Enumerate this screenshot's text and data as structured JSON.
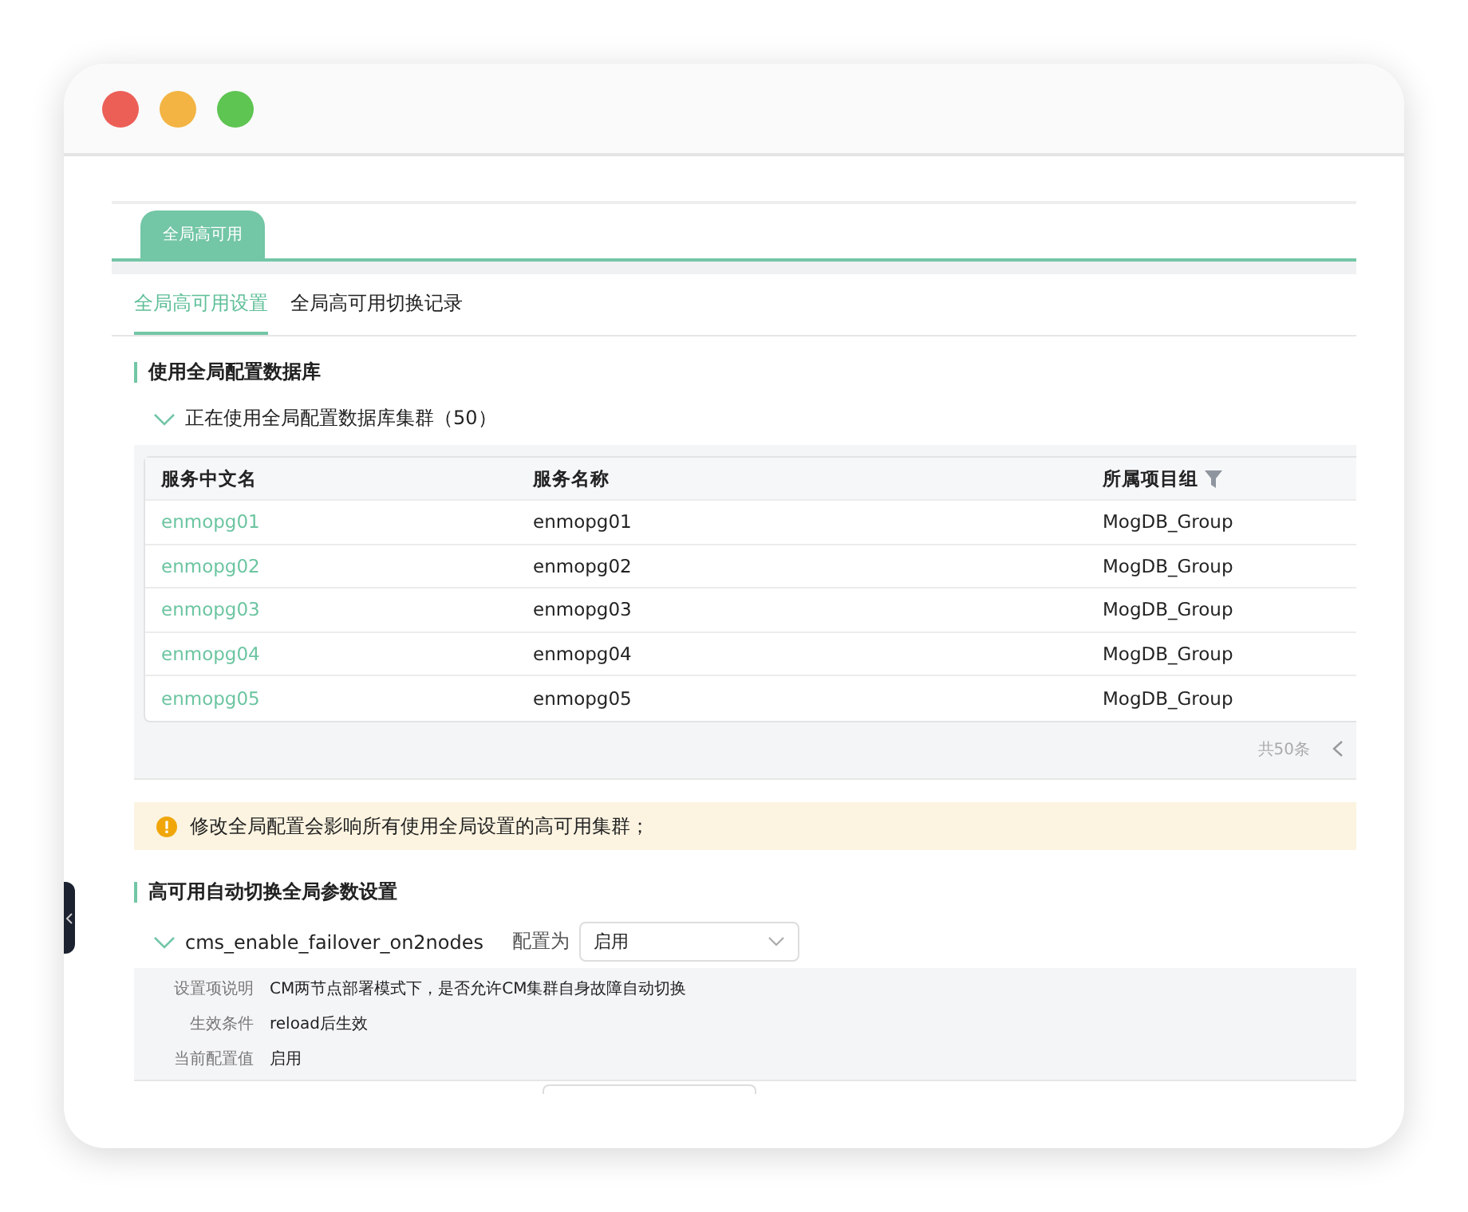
{
  "top_tabs": [
    {
      "label": "全局高可用",
      "selected": true
    }
  ],
  "sub_tabs": [
    {
      "label": "全局高可用设置",
      "selected": true
    },
    {
      "label": "全局高可用切换记录",
      "selected": false
    }
  ],
  "section1": {
    "title": "使用全局配置数据库",
    "group": {
      "label": "正在使用全局配置数据库集群（50）",
      "expanded": true
    }
  },
  "table": {
    "columns": [
      {
        "label": "服务中文名",
        "kind": "plain"
      },
      {
        "label": "服务名称",
        "kind": "plain"
      },
      {
        "label": "所属项目组",
        "kind": "filterable"
      }
    ],
    "rows": [
      [
        "enmopg01",
        "enmopg01",
        "MogDB_Group"
      ],
      [
        "enmopg02",
        "enmopg02",
        "MogDB_Group"
      ],
      [
        "enmopg03",
        "enmopg03",
        "MogDB_Group"
      ],
      [
        "enmopg04",
        "enmopg04",
        "MogDB_Group"
      ],
      [
        "enmopg05",
        "enmopg05",
        "MogDB_Group"
      ]
    ],
    "total": "共50条"
  },
  "alert": "修改全局配置会影响所有使用全局设置的高可用集群；",
  "section2": {
    "title": "高可用自动切换全局参数设置",
    "param": {
      "name": "cms_enable_failover_on2nodes",
      "expanded": true,
      "config_label": "配置为",
      "value": "启用",
      "details": [
        {
          "label": "设置项说明",
          "value": "CM两节点部署模式下，是否允许CM集群自身故障自动切换"
        },
        {
          "label": "生效条件",
          "value": "reload后生效"
        },
        {
          "label": "当前配置值",
          "value": "启用"
        }
      ]
    }
  }
}
